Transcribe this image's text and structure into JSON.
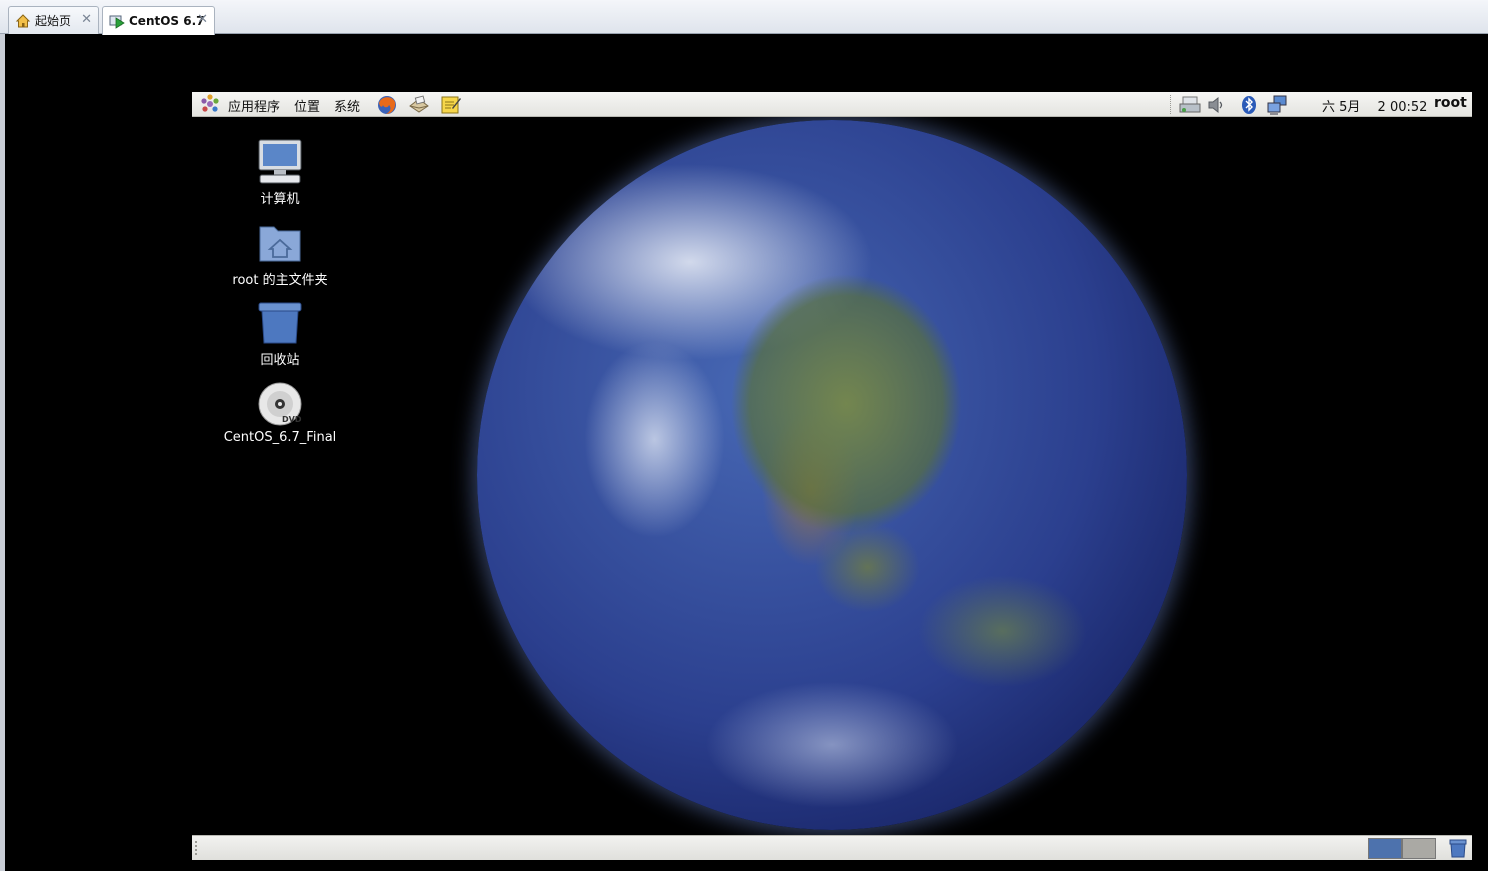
{
  "host": {
    "tabs": [
      {
        "label": "起始页",
        "icon": "home-icon",
        "active": false
      },
      {
        "label": "CentOS 6.7",
        "icon": "vm-running-icon",
        "active": true
      }
    ],
    "close_glyph": "✕"
  },
  "guest": {
    "top_panel": {
      "menus": [
        {
          "label": "应用程序"
        },
        {
          "label": "位置"
        },
        {
          "label": "系统"
        }
      ],
      "launchers": [
        "firefox-icon",
        "mail-icon",
        "notes-icon"
      ],
      "tray": [
        "network-printer-icon",
        "volume-icon",
        "bluetooth-icon",
        "network-icon"
      ],
      "clock": "六 5月 　2 00:52",
      "user": "root"
    },
    "desktop_icons": [
      {
        "label": "计算机",
        "icon": "computer-icon"
      },
      {
        "label": "root 的主文件夹",
        "icon": "home-folder-icon"
      },
      {
        "label": "回收站",
        "icon": "trash-icon"
      },
      {
        "label": "CentOS_6.7_Final",
        "icon": "dvd-icon"
      }
    ],
    "bottom_panel": {
      "workspaces": [
        {
          "active": true
        },
        {
          "active": false
        }
      ]
    }
  },
  "colors": {
    "panel_bg": "#e8e8e4",
    "workspace_active": "#4d72ad",
    "workspace_idle": "#aaa9a4",
    "desktop_bg": "#000000"
  }
}
